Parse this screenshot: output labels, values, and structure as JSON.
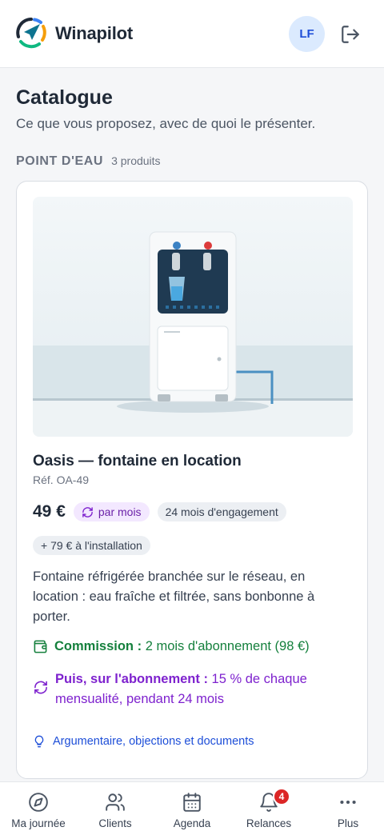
{
  "app": {
    "name": "Winapilot"
  },
  "user": {
    "initials": "LF"
  },
  "page": {
    "title": "Catalogue",
    "subtitle": "Ce que vous proposez, avec de quoi le présenter."
  },
  "section": {
    "title": "POINT D'EAU",
    "count": "3 produits"
  },
  "product": {
    "name": "Oasis — fontaine en location",
    "ref": "Réf. OA-49",
    "price": "49 €",
    "period": "par mois",
    "engagement": "24 mois d'engagement",
    "install": "+ 79 € à l'installation",
    "description": "Fontaine réfrigérée branchée sur le réseau, en location : eau fraîche et filtrée, sans bonbonne à porter.",
    "commission_label": "Commission :",
    "commission_value": "2 mois d'abonnement (98 €)",
    "recurring_label": "Puis, sur l'abonnement :",
    "recurring_value": "15 % de chaque mensualité, pendant 24 mois",
    "args_link": "Argumentaire, objections et documents"
  },
  "nav": {
    "items": [
      {
        "label": "Ma journée",
        "icon": "compass-icon"
      },
      {
        "label": "Clients",
        "icon": "users-icon"
      },
      {
        "label": "Agenda",
        "icon": "calendar-icon"
      },
      {
        "label": "Relances",
        "icon": "bell-icon",
        "badge": "4"
      },
      {
        "label": "Plus",
        "icon": "more-icon"
      }
    ]
  },
  "colors": {
    "commission": "#15803d",
    "recurring": "#7e22ce",
    "link": "#1d4ed8",
    "badge": "#dc2626",
    "avatar_bg": "#dbeafe"
  }
}
